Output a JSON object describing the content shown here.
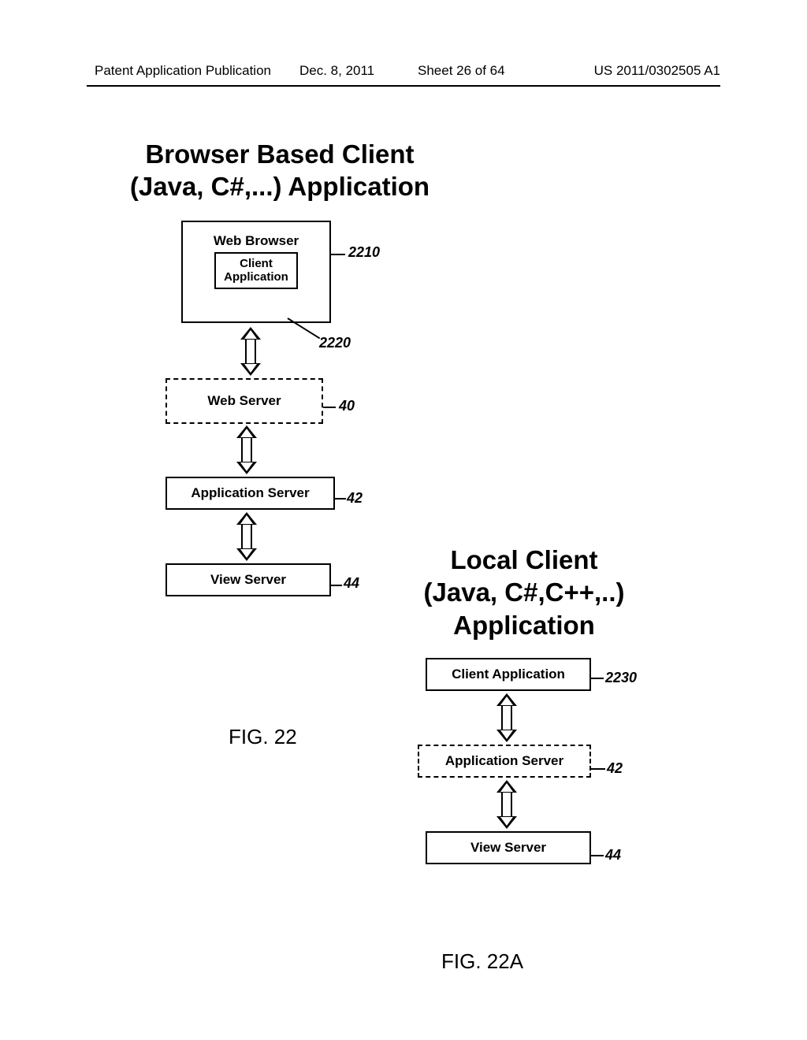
{
  "header": {
    "pub_label": "Patent Application Publication",
    "date": "Dec. 8, 2011",
    "sheet": "Sheet 26 of 64",
    "pub_number": "US 2011/0302505 A1"
  },
  "titles": {
    "browser_line1": "Browser Based Client",
    "browser_line2": "(Java, C#,...) Application",
    "local_line1": "Local Client",
    "local_line2": "(Java, C#,C++,..)",
    "local_line3": "Application"
  },
  "fig22": {
    "caption": "FIG. 22",
    "web_browser": "Web Browser",
    "client_app": "Client Application",
    "web_server": "Web Server",
    "app_server": "Application Server",
    "view_server": "View Server",
    "ref_2210": "2210",
    "ref_2220": "2220",
    "ref_40": "40",
    "ref_42": "42",
    "ref_44": "44"
  },
  "fig22a": {
    "caption": "FIG. 22A",
    "client_app": "Client Application",
    "app_server": "Application Server",
    "view_server": "View Server",
    "ref_2230": "2230",
    "ref_42": "42",
    "ref_44": "44"
  }
}
